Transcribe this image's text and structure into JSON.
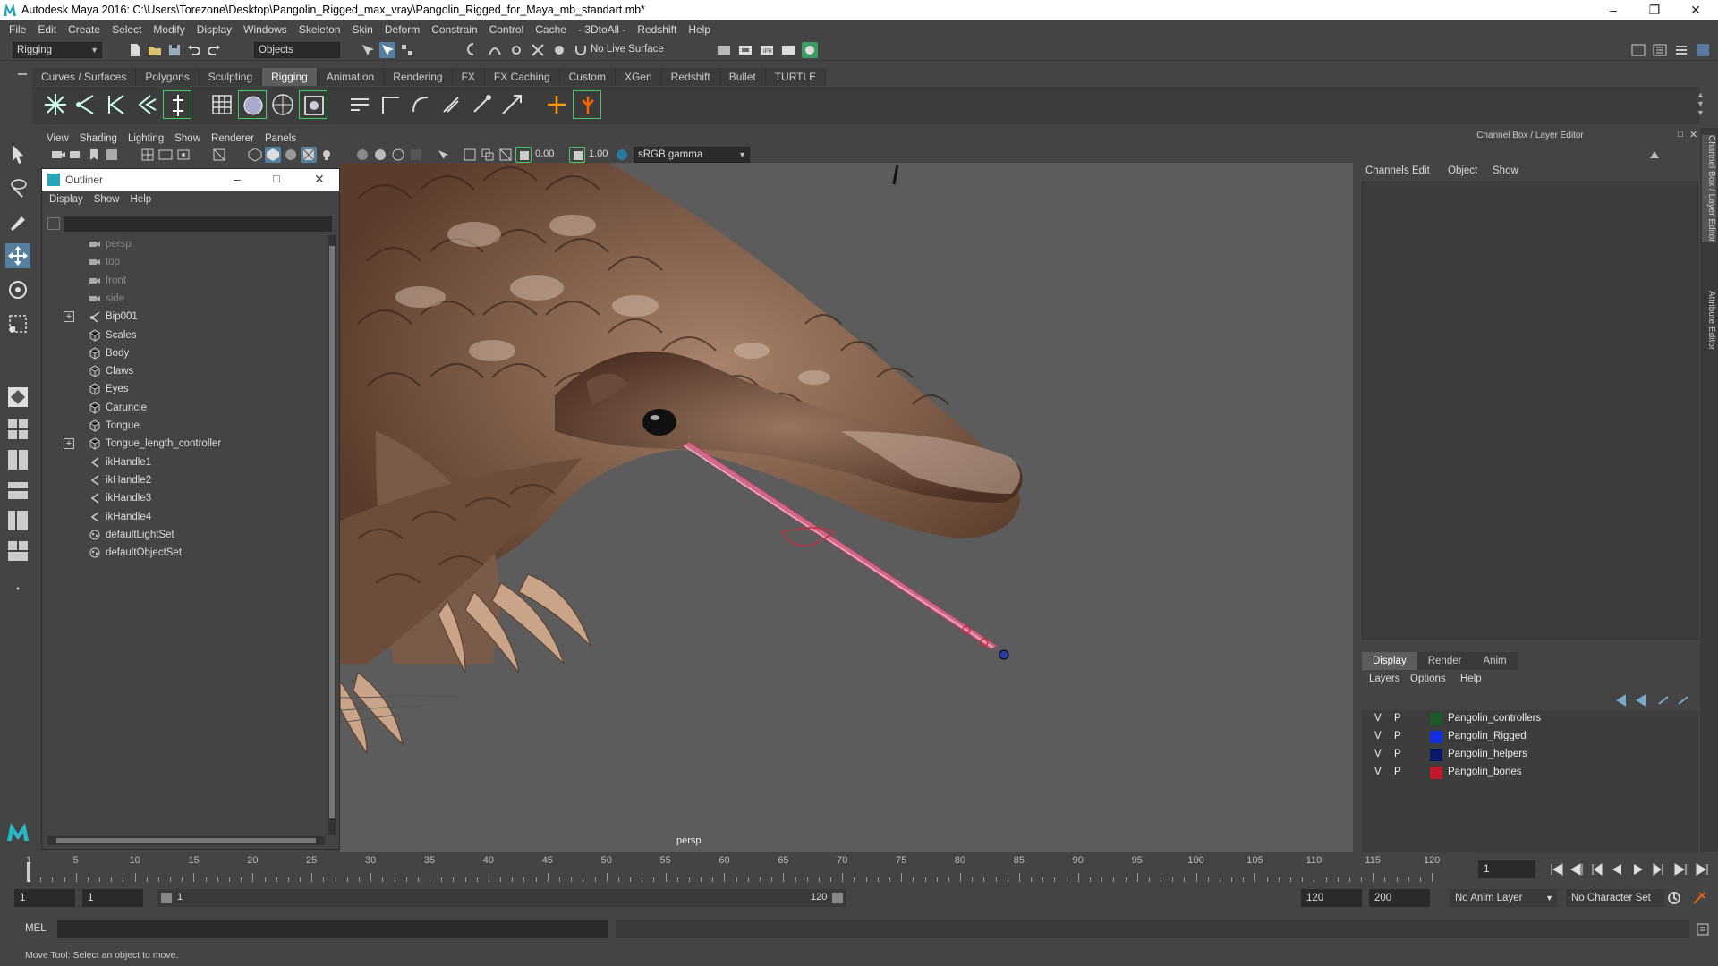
{
  "window": {
    "title": "Autodesk Maya 2016: C:\\Users\\Torezone\\Desktop\\Pangolin_Rigged_max_vray\\Pangolin_Rigged_for_Maya_mb_standart.mb*"
  },
  "menubar": [
    "File",
    "Edit",
    "Create",
    "Select",
    "Modify",
    "Display",
    "Windows",
    "Skeleton",
    "Skin",
    "Deform",
    "Constrain",
    "Control",
    "Cache",
    "- 3DtoAll -",
    "Redshift",
    "Help"
  ],
  "status": {
    "mode": "Rigging",
    "selection_mask": "Objects",
    "live_surface": "No Live Surface"
  },
  "shelf_tabs": [
    "Curves / Surfaces",
    "Polygons",
    "Sculpting",
    "Rigging",
    "Animation",
    "Rendering",
    "FX",
    "FX Caching",
    "Custom",
    "XGen",
    "Redshift",
    "Bullet",
    "TURTLE"
  ],
  "active_shelf": "Rigging",
  "viewport": {
    "menu": [
      "View",
      "Shading",
      "Lighting",
      "Show",
      "Renderer",
      "Panels"
    ],
    "near": "0.00",
    "far": "1.00",
    "color_space": "sRGB gamma",
    "camera_label": "persp"
  },
  "outliner": {
    "title": "Outliner",
    "menu": [
      "Display",
      "Show",
      "Help"
    ],
    "items": [
      {
        "label": "persp",
        "dim": true,
        "icon": "camera"
      },
      {
        "label": "top",
        "dim": true,
        "icon": "camera"
      },
      {
        "label": "front",
        "dim": true,
        "icon": "camera"
      },
      {
        "label": "side",
        "dim": true,
        "icon": "camera"
      },
      {
        "label": "Bip001",
        "dim": false,
        "icon": "joint",
        "expandable": true
      },
      {
        "label": "Scales",
        "dim": false,
        "icon": "mesh"
      },
      {
        "label": "Body",
        "dim": false,
        "icon": "mesh"
      },
      {
        "label": "Claws",
        "dim": false,
        "icon": "mesh"
      },
      {
        "label": "Eyes",
        "dim": false,
        "icon": "mesh"
      },
      {
        "label": "Caruncle",
        "dim": false,
        "icon": "mesh"
      },
      {
        "label": "Tongue",
        "dim": false,
        "icon": "mesh"
      },
      {
        "label": "Tongue_length_controller",
        "dim": false,
        "icon": "mesh",
        "expandable": true
      },
      {
        "label": "ikHandle1",
        "dim": false,
        "icon": "ik"
      },
      {
        "label": "ikHandle2",
        "dim": false,
        "icon": "ik"
      },
      {
        "label": "ikHandle3",
        "dim": false,
        "icon": "ik"
      },
      {
        "label": "ikHandle4",
        "dim": false,
        "icon": "ik"
      },
      {
        "label": "defaultLightSet",
        "dim": false,
        "icon": "set"
      },
      {
        "label": "defaultObjectSet",
        "dim": false,
        "icon": "set"
      }
    ]
  },
  "channel_box": {
    "title": "Channel Box / Layer Editor",
    "menu": [
      "Channels",
      "Edit",
      "Object",
      "Show"
    ],
    "layer_tabs": [
      "Display",
      "Render",
      "Anim"
    ],
    "layer_menu": [
      "Layers",
      "Options",
      "Help"
    ],
    "layers": [
      {
        "v": "V",
        "p": "P",
        "color": "#1d5a2a",
        "name": "Pangolin_controllers"
      },
      {
        "v": "V",
        "p": "P",
        "color": "#1030e0",
        "name": "Pangolin_Rigged"
      },
      {
        "v": "V",
        "p": "P",
        "color": "#0a1a6a",
        "name": "Pangolin_helpers"
      },
      {
        "v": "V",
        "p": "P",
        "color": "#c0182a",
        "name": "Pangolin_bones"
      }
    ]
  },
  "side_tabs": [
    "Channel Box / Layer Editor",
    "Attribute Editor"
  ],
  "timeline": {
    "labels": [
      "1",
      "5",
      "10",
      "15",
      "20",
      "25",
      "30",
      "35",
      "40",
      "45",
      "50",
      "55",
      "60",
      "65",
      "70",
      "75",
      "80",
      "85",
      "90",
      "95",
      "100",
      "105",
      "110",
      "115",
      "120"
    ],
    "current_frame": "1"
  },
  "range": {
    "start": "1",
    "playback_start": "1",
    "slider_start": "1",
    "slider_end": "120",
    "playback_end": "120",
    "end": "200",
    "anim_layer": "No Anim Layer",
    "character_set": "No Character Set"
  },
  "command": {
    "lang": "MEL"
  },
  "help_line": "Move Tool: Select an object to move."
}
